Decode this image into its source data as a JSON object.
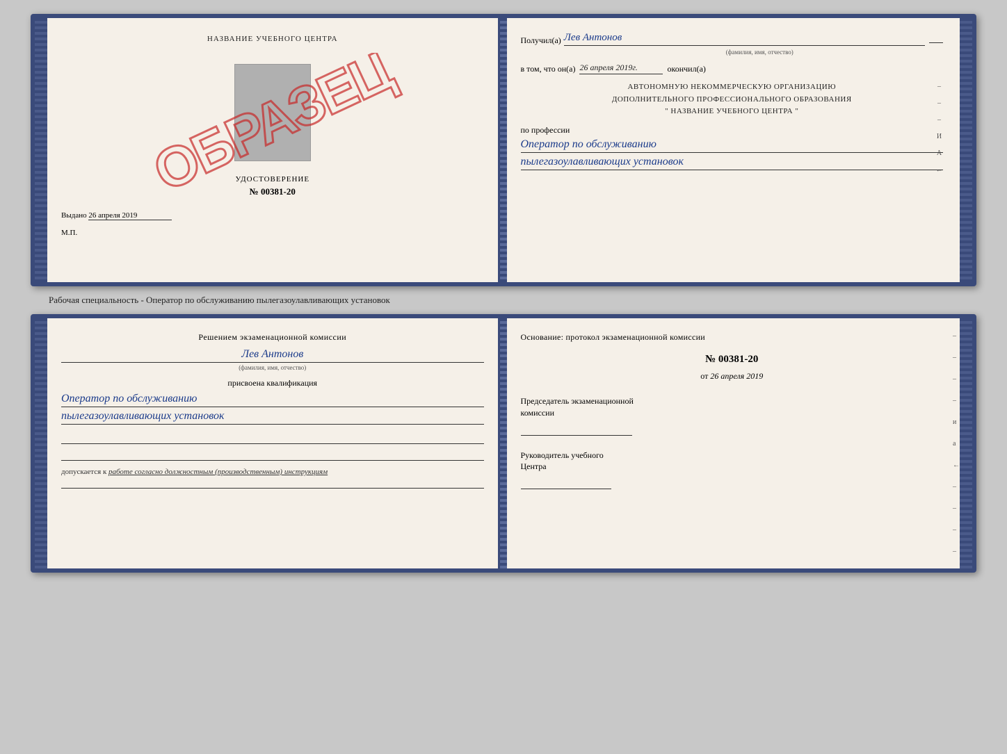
{
  "top_book": {
    "left_page": {
      "org_name": "НАЗВАНИЕ УЧЕБНОГО ЦЕНТРА",
      "stamp_text": "ОБРАЗЕЦ",
      "udostoverenie_label": "УДОСТОВЕРЕНИЕ",
      "udostoverenie_number": "№ 00381-20",
      "vydano_label": "Выдано",
      "vydano_date": "26 апреля 2019",
      "mp_label": "М.П."
    },
    "right_page": {
      "poluchil_label": "Получил(а)",
      "poluchil_name": "Лев Антонов",
      "fio_hint": "(фамилия, имя, отчество)",
      "vtom_label": "в том, что он(а)",
      "vtom_date": "26 апреля 2019г.",
      "okonchil_label": "окончил(а)",
      "org_line1": "АВТОНОМНУЮ НЕКОММЕРЧЕСКУЮ ОРГАНИЗАЦИЮ",
      "org_line2": "ДОПОЛНИТЕЛЬНОГО ПРОФЕССИОНАЛЬНОГО ОБРАЗОВАНИЯ",
      "org_line3": "\"  НАЗВАНИЕ УЧЕБНОГО ЦЕНТРА  \"",
      "po_professii_label": "по профессии",
      "profession_line1": "Оператор по обслуживанию",
      "profession_line2": "пылегазоулавливающих установок",
      "right_dashes": [
        "-",
        "-",
        "-",
        "-",
        "и",
        "а",
        "←",
        "-",
        "-",
        "-",
        "-",
        "-"
      ]
    }
  },
  "between_label": "Рабочая специальность - Оператор по обслуживанию пылегазоулавливающих установок",
  "bottom_book": {
    "left_page": {
      "resheniem_label": "Решением экзаменационной комиссии",
      "person_name": "Лев Антонов",
      "fio_hint": "(фамилия, имя, отчество)",
      "prisvoyena_label": "присвоена квалификация",
      "qual_line1": "Оператор по обслуживанию",
      "qual_line2": "пылегазоулавливающих установок",
      "dopuskaetsya_text": "допускается к",
      "dopuskaetsya_italic": "работе согласно должностным (производственным) инструкциям"
    },
    "right_page": {
      "osnovanie_label": "Основание: протокол экзаменационной комиссии",
      "protocol_number": "№ 00381-20",
      "ot_label": "от",
      "ot_date": "26 апреля 2019",
      "predsedatel_line1": "Председатель экзаменационной",
      "predsedatel_line2": "комиссии",
      "rukovoditel_line1": "Руководитель учебного",
      "rukovoditel_line2": "Центра",
      "right_dashes": [
        "-",
        "-",
        "-",
        "-",
        "и",
        "а",
        "←",
        "-",
        "-",
        "-",
        "-",
        "-"
      ]
    }
  }
}
